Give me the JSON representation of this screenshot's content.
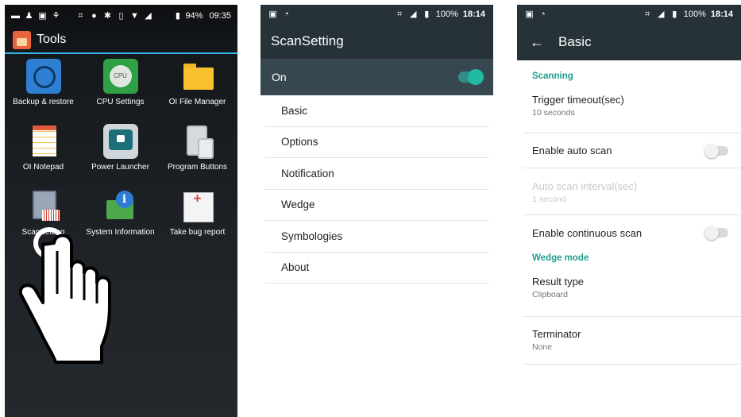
{
  "screen1": {
    "status": {
      "battery": "94%",
      "time": "09:35"
    },
    "title": "Tools",
    "apps": [
      {
        "label": "Backup & restore"
      },
      {
        "label": "CPU Settings"
      },
      {
        "label": "OI File Manager"
      },
      {
        "label": "OI Notepad"
      },
      {
        "label": "Power Launcher"
      },
      {
        "label": "Program Buttons"
      },
      {
        "label": "ScanSetting"
      },
      {
        "label": "System Information"
      },
      {
        "label": "Take bug report"
      }
    ]
  },
  "screen2": {
    "status": {
      "battery": "100%",
      "time": "18:14"
    },
    "title": "ScanSetting",
    "master_switch": {
      "label": "On",
      "checked": true
    },
    "items": [
      "Basic",
      "Options",
      "Notification",
      "Wedge",
      "Symbologies",
      "About"
    ]
  },
  "screen3": {
    "status": {
      "battery": "100%",
      "time": "18:14"
    },
    "title": "Basic",
    "cat_scanning": "Scanning",
    "trigger_timeout": {
      "title": "Trigger timeout(sec)",
      "summary": "10 seconds"
    },
    "auto_scan": {
      "title": "Enable auto scan",
      "checked": false
    },
    "auto_scan_interval": {
      "title": "Auto scan interval(sec)",
      "summary": "1 second"
    },
    "continuous_scan": {
      "title": "Enable continuous scan",
      "checked": false
    },
    "cat_wedge": "Wedge mode",
    "result_type": {
      "title": "Result type",
      "summary": "Clipboard"
    },
    "terminator": {
      "title": "Terminator",
      "summary": "None"
    }
  },
  "colors": {
    "accent": "#1f9d8f",
    "toolbar": "#263238",
    "switch_bar": "#37474f",
    "launcher_underline": "#33b5e5"
  }
}
